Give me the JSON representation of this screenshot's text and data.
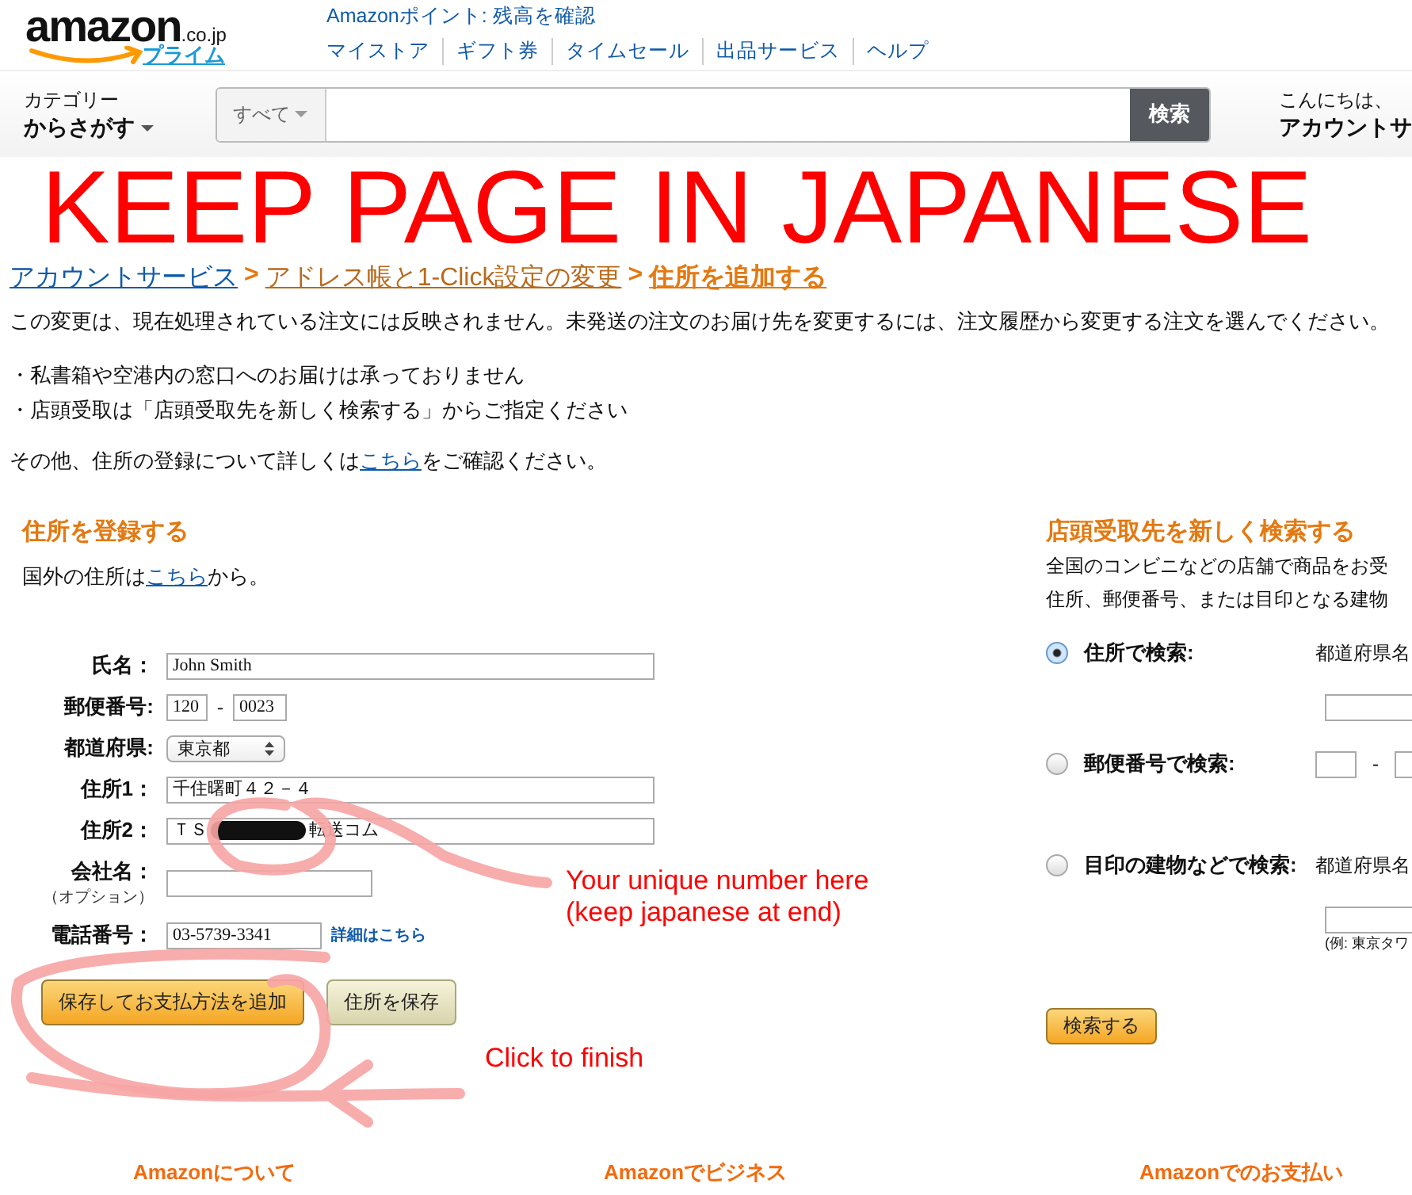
{
  "header": {
    "logo": {
      "wordmark": "amazon",
      "domain": ".co.jp",
      "tagline": "プライム"
    },
    "points_link": "Amazonポイント: 残高を確認",
    "nav_links": [
      "マイストア",
      "ギフト券",
      "タイムセール",
      "出品サービス",
      "ヘルプ"
    ],
    "category": {
      "label": "カテゴリー",
      "value": "からさがす"
    },
    "search": {
      "scope": "すべて",
      "button": "検索"
    },
    "account": {
      "greeting": "こんにちは、",
      "label": "アカウントサ"
    }
  },
  "breadcrumb": [
    {
      "label": "アカウントサービス",
      "kind": "link"
    },
    {
      "label": "アドレス帳と1-Click設定の変更",
      "kind": "link"
    },
    {
      "label": "住所を追加する",
      "kind": "current"
    }
  ],
  "breadcrumb_separator": ">",
  "notice": "この変更は、現在処理されている注文には反映されません。未発送の注文のお届け先を変更するには、注文履歴から変更する注文を選んでください。",
  "bullets": [
    "・私書箱や空港内の窓口へのお届けは承っておりません",
    "・店頭受取は「店頭受取先を新しく検索する」からご指定ください"
  ],
  "more_info": {
    "before": "その他、住所の登録について詳しくは",
    "link": "こちら",
    "after": "をご確認ください。"
  },
  "register": {
    "heading": "住所を登録する",
    "overseas": {
      "before": "国外の住所は",
      "link": "こちら",
      "after": "から。"
    },
    "fields": [
      {
        "kind": "wide",
        "label": "氏名：",
        "value": "John Smith"
      },
      {
        "kind": "postal",
        "label": "郵便番号:",
        "values": [
          "120",
          "0023"
        ],
        "separator": "-"
      },
      {
        "kind": "select",
        "label": "都道府県:",
        "value": "東京都"
      },
      {
        "kind": "wide",
        "label": "住所1：",
        "value": "千住曙町４２－４"
      },
      {
        "kind": "redacted",
        "label": "住所2：",
        "value_before": "ＴＳ",
        "value_after": "転送コム"
      },
      {
        "kind": "short",
        "label": "会社名：",
        "sublabel": "（オプション）"
      },
      {
        "kind": "phone",
        "label": "電話番号：",
        "value": "03-5739-3341",
        "link": "詳細はこちら"
      }
    ],
    "buttons": [
      {
        "label": "保存してお支払方法を追加",
        "kind": "primary"
      },
      {
        "label": "住所を保存",
        "kind": "secondary"
      }
    ]
  },
  "store_pickup": {
    "heading": "店頭受取先を新しく検索する",
    "lines": [
      "全国のコンビニなどの店舗で商品をお受",
      "住所、郵便番号、または目印となる建物"
    ],
    "options": [
      {
        "kind": "address",
        "label": "住所で検索:",
        "selected": true,
        "hint": "都道府県名"
      },
      {
        "kind": "postal",
        "label": "郵便番号で検索:",
        "selected": false,
        "separator": "-"
      },
      {
        "kind": "landmark",
        "label": "目印の建物などで検索:",
        "selected": false,
        "hint": "都道府県名",
        "example": "(例: 東京タワ"
      }
    ],
    "button": "検索する"
  },
  "annotations": {
    "title": "KEEP PAGE IN JAPANESE",
    "note_lines": [
      "Your unique number here",
      "(keep japanese at end)"
    ],
    "finish": "Click to finish"
  },
  "footer": [
    "Amazonについて",
    "Amazonでビジネス",
    "Amazonでのお支払い"
  ]
}
